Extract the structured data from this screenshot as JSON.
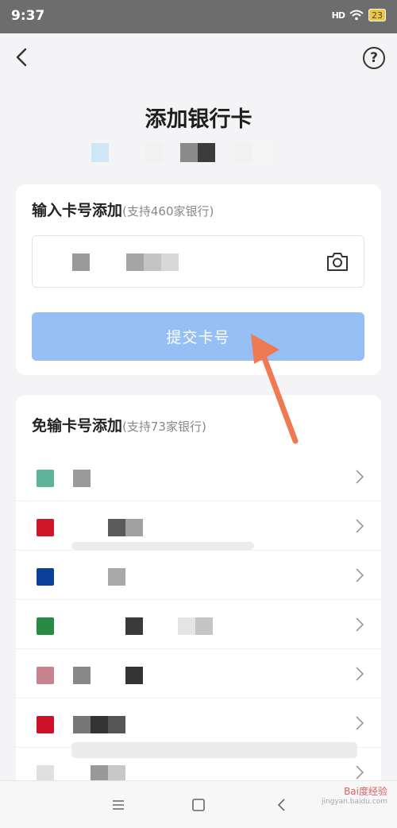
{
  "status_bar": {
    "time": "9:37",
    "signal_label": "HD",
    "battery_level": "23"
  },
  "header": {
    "back_icon": "chevron-left-icon",
    "help_icon": "question-circle-icon",
    "help_glyph": "?"
  },
  "page": {
    "title": "添加银行卡"
  },
  "manual_section": {
    "title": "输入卡号添加",
    "subtitle": "(支持460家银行)",
    "camera_icon": "camera-icon",
    "submit_label": "提交卡号"
  },
  "quick_section": {
    "title": "免输卡号添加",
    "subtitle": "(支持73家银行)",
    "banks": [
      {
        "logo_color": "#5fb39a"
      },
      {
        "logo_color": "#d0172a"
      },
      {
        "logo_color": "#0c3f9a"
      },
      {
        "logo_color": "#2a8a45"
      },
      {
        "logo_color": "#c7848e"
      },
      {
        "logo_color": "#cc1228"
      },
      {
        "logo_color": "#e0e0e0"
      }
    ]
  },
  "nav_bar": {
    "menu_icon": "menu-icon",
    "home_icon": "square-home-icon",
    "back_icon": "triangle-back-icon"
  },
  "watermark": {
    "brand": "Bai度经验",
    "url": "jingyan.baidu.com"
  },
  "colors": {
    "accent_button": "#96bff5",
    "annotation_arrow": "#f07a4f"
  }
}
